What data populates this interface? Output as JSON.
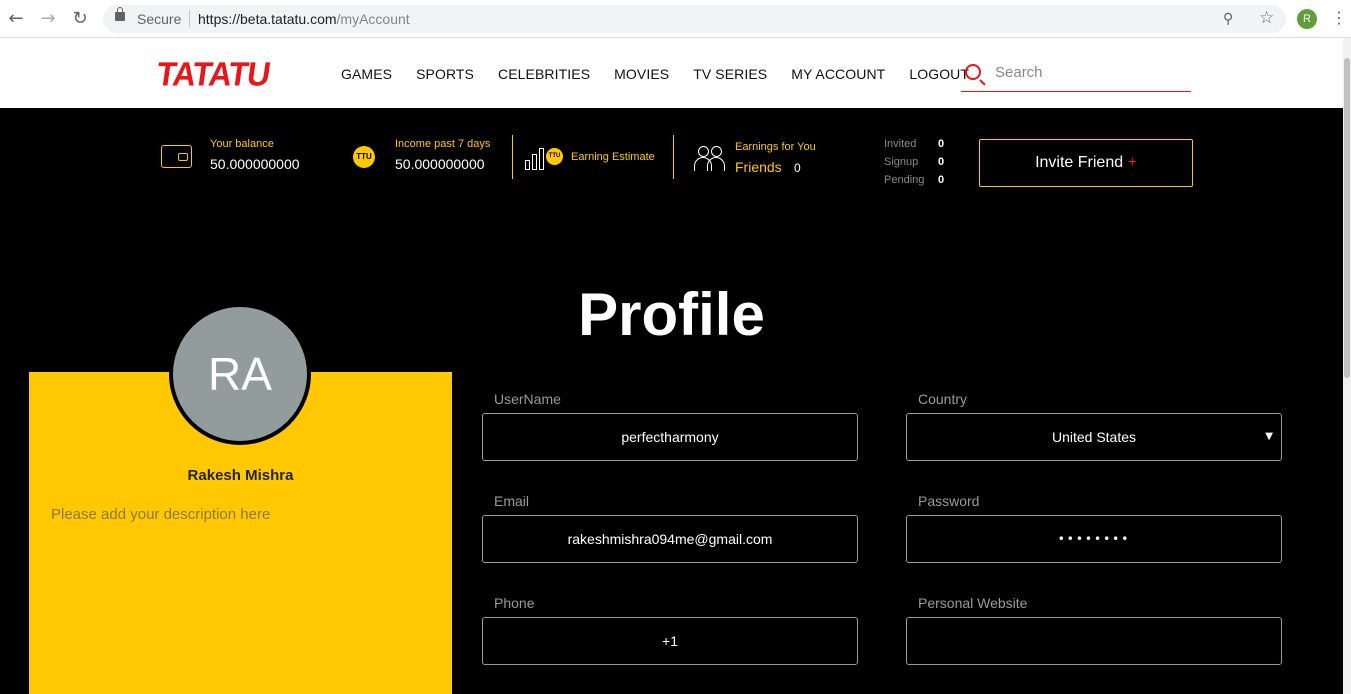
{
  "browser": {
    "secure_label": "Secure",
    "url_host": "https://beta.tatatu.com",
    "url_path": "/myAccount",
    "profile_initial": "R"
  },
  "header": {
    "logo": "TATATU",
    "menu": [
      "GAMES",
      "SPORTS",
      "CELEBRITIES",
      "MOVIES",
      "TV SERIES",
      "MY ACCOUNT",
      "LOGOUT"
    ],
    "search_placeholder": "Search"
  },
  "stats": {
    "balance_label": "Your balance",
    "balance_value": "50.000000000",
    "income_label": "Income past 7 days",
    "income_value": "50.000000000",
    "coin_label": "TTU",
    "earning_estimate_label": "Earning Estimate",
    "earnings_label": "Earnings for You",
    "friends_label": "Friends",
    "friends_value": "0",
    "invited_label": "Invited",
    "invited_value": "0",
    "signup_label": "Signup",
    "signup_value": "0",
    "pending_label": "Pending",
    "pending_value": "0",
    "invite_button": "Invite Friend",
    "invite_plus": "+"
  },
  "profile": {
    "title": "Profile",
    "initials": "RA",
    "name": "Rakesh Mishra",
    "description_placeholder": "Please add your description here",
    "fields": {
      "username_label": "UserName",
      "username_value": "perfectharmony",
      "country_label": "Country",
      "country_value": "United States",
      "email_label": "Email",
      "email_value": "rakeshmishra094me@gmail.com",
      "password_label": "Password",
      "password_value": "••••••••",
      "phone_label": "Phone",
      "phone_value": "+1",
      "website_label": "Personal Website",
      "website_value": ""
    }
  },
  "colors": {
    "accent": "#ffc800",
    "brand": "#e8151b",
    "background": "#000000"
  }
}
